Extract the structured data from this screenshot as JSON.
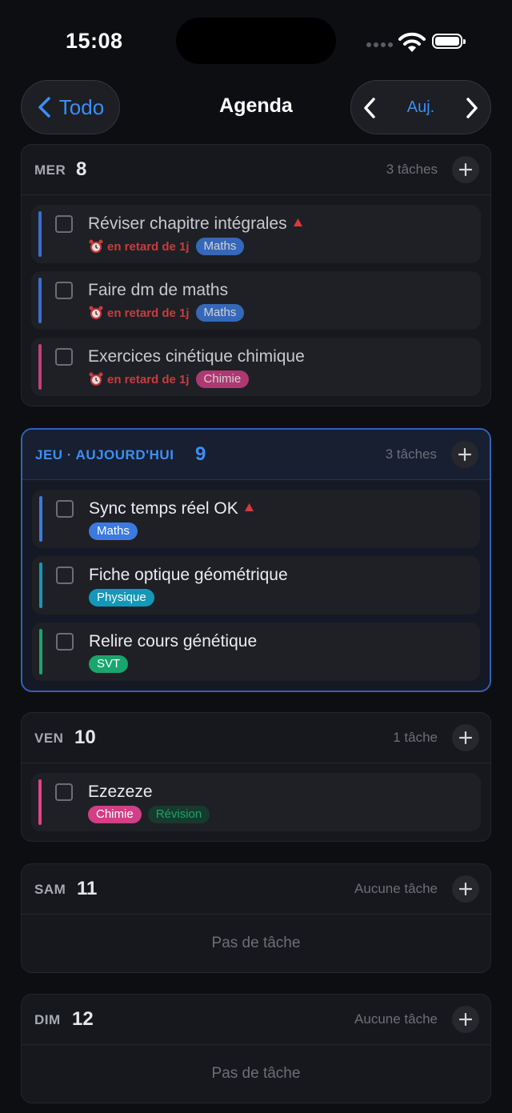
{
  "status_bar": {
    "time": "15:08"
  },
  "nav": {
    "back_label": "Todo",
    "title": "Agenda",
    "today_label": "Auj."
  },
  "colors": {
    "accent": "#3b8ff6",
    "overdue": "#c83c3f",
    "maths": "#3b7ae0",
    "chimie": "#d23f86",
    "physique": "#1597b8",
    "svt": "#18a56e",
    "revision_bg": "#163a2d",
    "revision_text": "#1fa36c"
  },
  "days": [
    {
      "name": "MER",
      "number": "8",
      "count": "3 tâches",
      "today": false,
      "dim": true,
      "tasks": [
        {
          "title": "Réviser chapitre intégrales",
          "priority": true,
          "late": "en retard de 1j",
          "tags": [
            "Maths"
          ],
          "bar": "#3b6fd0"
        },
        {
          "title": "Faire dm de maths",
          "priority": false,
          "late": "en retard de 1j",
          "tags": [
            "Maths"
          ],
          "bar": "#3b6fd0"
        },
        {
          "title": "Exercices cinétique chimique",
          "priority": false,
          "late": "en retard de 1j",
          "tags": [
            "Chimie"
          ],
          "bar": "#c23f7e"
        }
      ]
    },
    {
      "name": "JEU · AUJOURD'HUI",
      "number": "9",
      "count": "3 tâches",
      "today": true,
      "tasks": [
        {
          "title": "Sync temps réel OK",
          "priority": true,
          "tags": [
            "Maths"
          ],
          "bar": "#3b7ae0"
        },
        {
          "title": "Fiche optique géométrique",
          "priority": false,
          "tags": [
            "Physique"
          ],
          "bar": "#1597b8"
        },
        {
          "title": "Relire cours génétique",
          "priority": false,
          "tags": [
            "SVT"
          ],
          "bar": "#18a56e"
        }
      ]
    },
    {
      "name": "VEN",
      "number": "10",
      "count": "1 tâche",
      "today": false,
      "tasks": [
        {
          "title": "Ezezeze",
          "priority": false,
          "tags": [
            "Chimie",
            "Révision"
          ],
          "bar": "#e5408a"
        }
      ]
    },
    {
      "name": "SAM",
      "number": "11",
      "count": "Aucune tâche",
      "today": false,
      "tasks": [],
      "empty_label": "Pas de tâche"
    },
    {
      "name": "DIM",
      "number": "12",
      "count": "Aucune tâche",
      "today": false,
      "tasks": [],
      "empty_label": "Pas de tâche"
    }
  ]
}
